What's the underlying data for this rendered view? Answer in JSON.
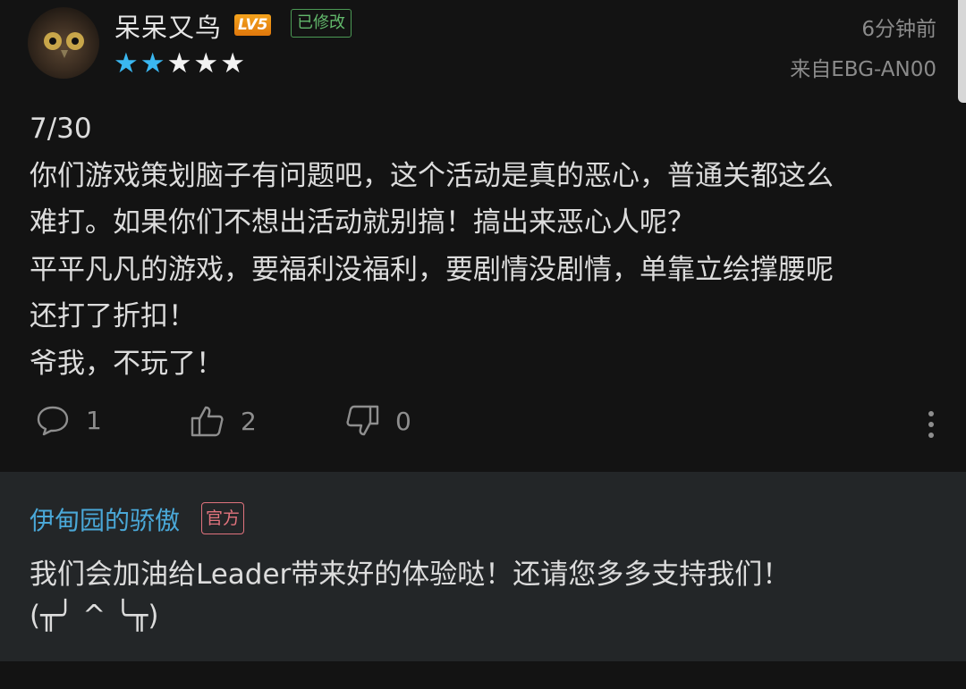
{
  "review": {
    "username": "呆呆又鸟",
    "level_badge": "LV5",
    "modified_badge": "已修改",
    "rating": {
      "stars_filled": 2,
      "stars_total": 5
    },
    "time": "6分钟前",
    "device": "来自EBG-AN00",
    "content_lines": [
      "7/30",
      "你们游戏策划脑子有问题吧，这个活动是真的恶心，普通关都这么",
      "难打。如果你们不想出活动就别搞！搞出来恶心人呢？",
      "平平凡凡的游戏，要福利没福利，要剧情没剧情，单靠立绘撑腰呢",
      "还打了折扣！",
      "爷我，不玩了！"
    ],
    "actions": {
      "comments": "1",
      "likes": "2",
      "dislikes": "0"
    }
  },
  "reply": {
    "author": "伊甸园的骄傲",
    "official_badge": "官方",
    "text_lines": [
      "我们会加油给Leader带来好的体验哒！还请您多多支持我们！",
      "(╥╯ ^ ╰╥)"
    ]
  },
  "colors": {
    "background": "#131313",
    "reply_background": "#232628",
    "star_filled": "#3ab7f0",
    "reply_name": "#4aa8d8",
    "official_badge": "#e0737d",
    "modified_badge": "#62b86b"
  },
  "icons": [
    "comment-icon",
    "thumbs-up-icon",
    "thumbs-down-icon",
    "more-vertical-icon",
    "star-icon"
  ]
}
